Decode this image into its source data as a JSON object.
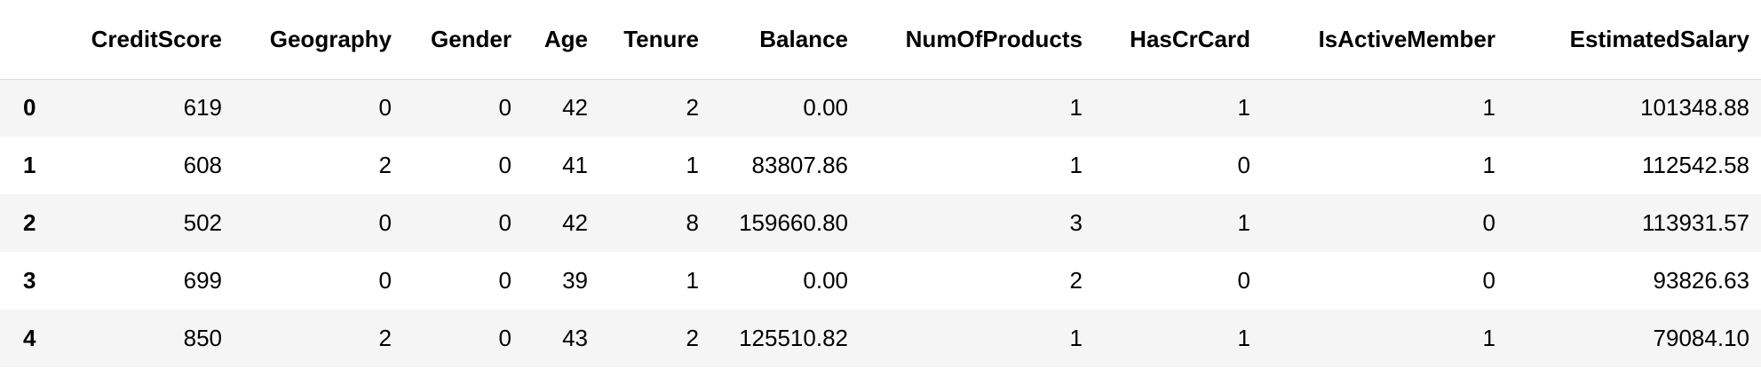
{
  "table": {
    "index_header": "",
    "columns": [
      "CreditScore",
      "Geography",
      "Gender",
      "Age",
      "Tenure",
      "Balance",
      "NumOfProducts",
      "HasCrCard",
      "IsActiveMember",
      "EstimatedSalary"
    ],
    "rows": [
      {
        "index": "0",
        "cells": [
          "619",
          "0",
          "0",
          "42",
          "2",
          "0.00",
          "1",
          "1",
          "1",
          "101348.88"
        ]
      },
      {
        "index": "1",
        "cells": [
          "608",
          "2",
          "0",
          "41",
          "1",
          "83807.86",
          "1",
          "0",
          "1",
          "112542.58"
        ]
      },
      {
        "index": "2",
        "cells": [
          "502",
          "0",
          "0",
          "42",
          "8",
          "159660.80",
          "3",
          "1",
          "0",
          "113931.57"
        ]
      },
      {
        "index": "3",
        "cells": [
          "699",
          "0",
          "0",
          "39",
          "1",
          "0.00",
          "2",
          "0",
          "0",
          "93826.63"
        ]
      },
      {
        "index": "4",
        "cells": [
          "850",
          "2",
          "0",
          "43",
          "2",
          "125510.82",
          "1",
          "1",
          "1",
          "79084.10"
        ]
      }
    ]
  }
}
